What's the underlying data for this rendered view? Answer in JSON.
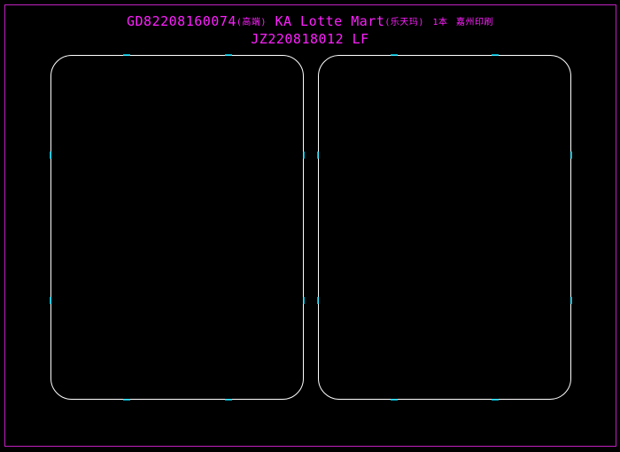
{
  "title": {
    "line1_code": "GD82208160074",
    "line1_tag1": "(高端)",
    "line1_brand": "KA Lotte Mart",
    "line1_tag2": "(乐天玛)",
    "line1_qty": "1本",
    "line1_tag3": "嘉州印刷",
    "line2": "JZ220818012 LF"
  },
  "colors": {
    "background": "#000000",
    "text": "#ff20ff",
    "frame": "#c020c0",
    "outline": "#ffffff",
    "marker": "#00e0ff"
  },
  "panels": [
    {
      "name": "left-panel"
    },
    {
      "name": "right-panel"
    }
  ]
}
